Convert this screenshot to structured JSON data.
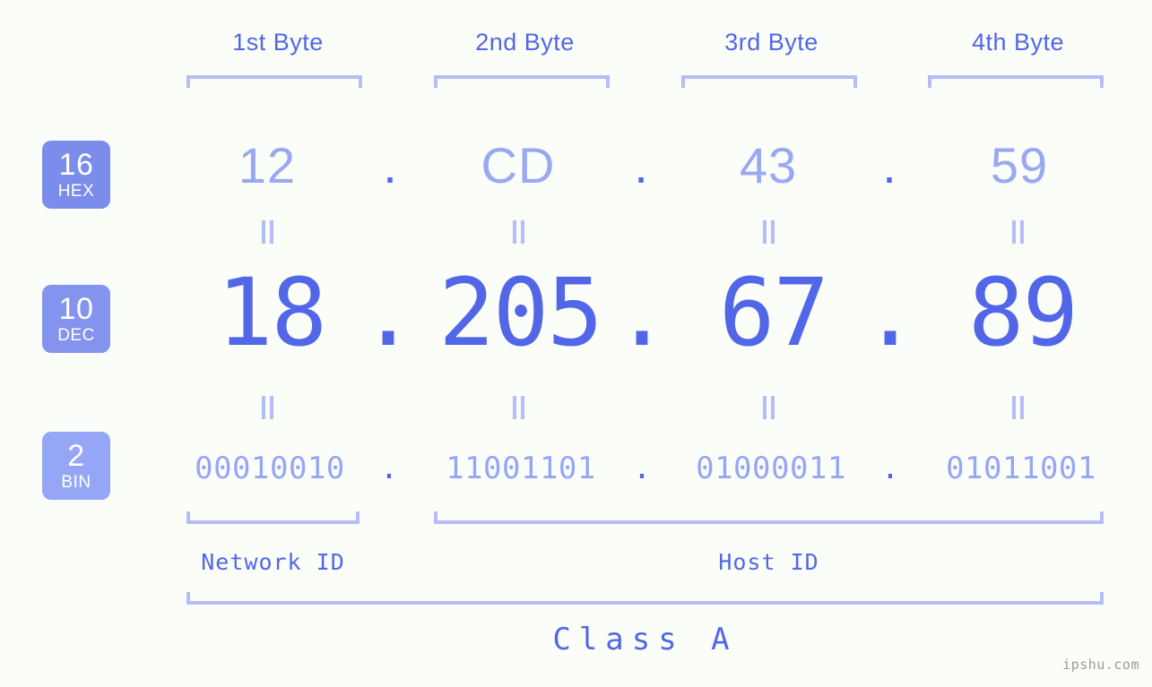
{
  "page": {
    "background_color": "#fbfdf8",
    "accent_color": "#5267e8",
    "muted_accent_color": "#96a6f6",
    "bracket_color": "#b4bdf7"
  },
  "byte_headers": [
    {
      "label": "1st Byte"
    },
    {
      "label": "2nd Byte"
    },
    {
      "label": "3rd Byte"
    },
    {
      "label": "4th Byte"
    }
  ],
  "rows": {
    "hex": {
      "badge_number": "16",
      "badge_label": "HEX",
      "badge_color": "#7b8ceb",
      "separator": ".",
      "values": [
        "12",
        "CD",
        "43",
        "59"
      ]
    },
    "dec": {
      "badge_number": "10",
      "badge_label": "DEC",
      "badge_color": "#8494ee",
      "separator": ".",
      "values": [
        "18",
        "205",
        "67",
        "89"
      ]
    },
    "bin": {
      "badge_number": "2",
      "badge_label": "BIN",
      "badge_color": "#96a6f6",
      "separator": ".",
      "values": [
        "00010010",
        "11001101",
        "01000011",
        "01011001"
      ]
    }
  },
  "connectors": {
    "glyph": "equals-double-bar",
    "count_per_row_gap": 4
  },
  "segments": {
    "network_id": {
      "label": "Network ID"
    },
    "host_id": {
      "label": "Host ID"
    },
    "class": {
      "label": "Class A"
    }
  },
  "watermark": {
    "text": "ipshu.com"
  }
}
